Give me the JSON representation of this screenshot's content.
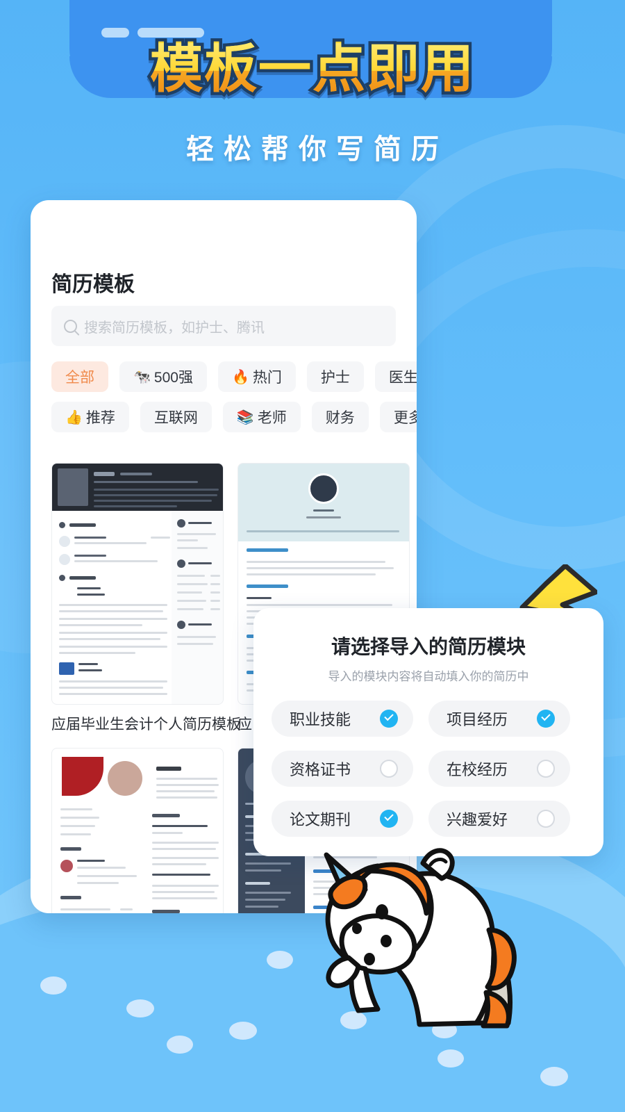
{
  "promo": {
    "headline": "模板一点即用",
    "subheadline": "轻松帮你写简历",
    "headline_color": "#ffd93a",
    "headline_outline": "#1d3f66",
    "background_color": "#5cb8f7"
  },
  "app": {
    "page_title": "简历模板",
    "search": {
      "placeholder": "搜索简历模板，如护士、腾讯",
      "value": "",
      "icon": "search-icon"
    },
    "categories": [
      {
        "label": "全部",
        "emoji": "",
        "active": true
      },
      {
        "label": "500强",
        "emoji": "🐄",
        "active": false
      },
      {
        "label": "热门",
        "emoji": "🔥",
        "active": false
      },
      {
        "label": "护士",
        "emoji": "",
        "active": false
      },
      {
        "label": "医生",
        "emoji": "",
        "active": false
      },
      {
        "label": "推荐",
        "emoji": "👍",
        "active": false
      },
      {
        "label": "互联网",
        "emoji": "",
        "active": false
      },
      {
        "label": "老师",
        "emoji": "📚",
        "active": false
      },
      {
        "label": "财务",
        "emoji": "",
        "active": false
      },
      {
        "label": "更多",
        "emoji": "",
        "active": false
      }
    ],
    "templates": [
      {
        "caption": "应届毕业生会计个人简历模板"
      },
      {
        "caption": "应"
      },
      {
        "caption": ""
      },
      {
        "caption": ""
      }
    ],
    "active_chip_bg": "#fde9e0",
    "active_chip_fg": "#f08a4b"
  },
  "modal": {
    "title": "请选择导入的简历模块",
    "subtitle": "导入的模块内容将自动填入你的简历中",
    "checked_color": "#21b4f2",
    "options": [
      {
        "label": "职业技能",
        "checked": true
      },
      {
        "label": "项目经历",
        "checked": true
      },
      {
        "label": "资格证书",
        "checked": false
      },
      {
        "label": "在校经历",
        "checked": false
      },
      {
        "label": "论文期刊",
        "checked": true
      },
      {
        "label": "兴趣爱好",
        "checked": false
      }
    ]
  },
  "decor": {
    "bolt": "lightning-bolt-icon",
    "mascot": "unicorn-mascot",
    "mascot_body": "#ffffff",
    "mascot_mane": "#f47b20",
    "mascot_horn": "#7ec8f0"
  }
}
